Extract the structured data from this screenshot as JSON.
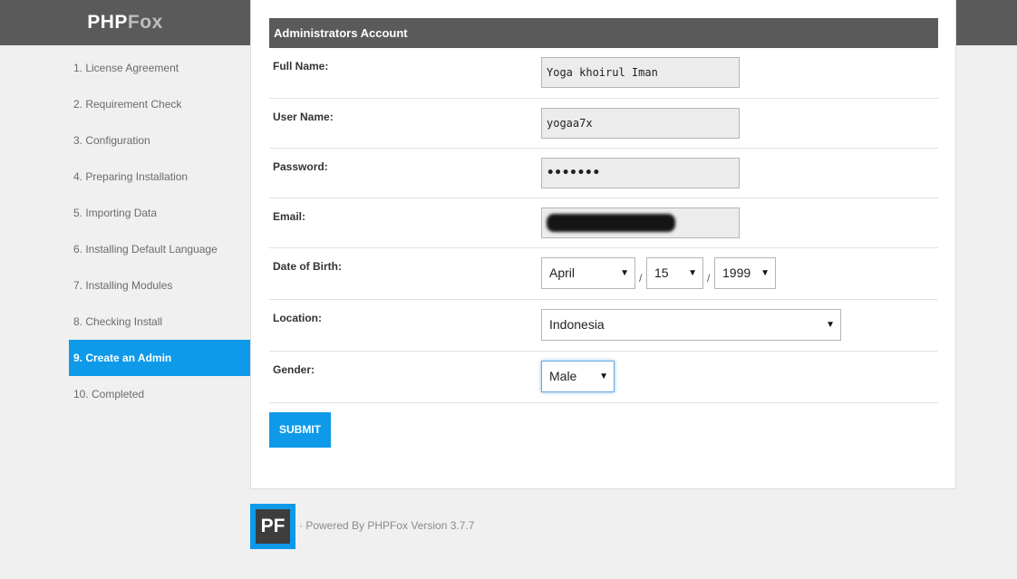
{
  "brand": {
    "part1": "PHP",
    "part2": "Fox"
  },
  "steps": [
    {
      "label": "1. License Agreement"
    },
    {
      "label": "2. Requirement Check"
    },
    {
      "label": "3. Configuration"
    },
    {
      "label": "4. Preparing Installation"
    },
    {
      "label": "5. Importing Data"
    },
    {
      "label": "6. Installing Default Language"
    },
    {
      "label": "7. Installing Modules"
    },
    {
      "label": "8. Checking Install"
    },
    {
      "label": "9. Create an Admin",
      "active": true
    },
    {
      "label": "10. Completed"
    }
  ],
  "panel": {
    "title": "Administrators Account"
  },
  "form": {
    "full_name": {
      "label": "Full Name:",
      "value": "Yoga khoirul Iman"
    },
    "user_name": {
      "label": "User Name:",
      "value": "yogaa7x"
    },
    "password": {
      "label": "Password:",
      "value": "•••••••"
    },
    "email": {
      "label": "Email:",
      "value": ""
    },
    "dob": {
      "label": "Date of Birth:",
      "month": "April",
      "day": "15",
      "year": "1999",
      "separator": "/"
    },
    "location": {
      "label": "Location:",
      "value": "Indonesia"
    },
    "gender": {
      "label": "Gender:",
      "value": "Male"
    },
    "submit_label": "SUBMIT"
  },
  "footer": {
    "logo_text": "PF",
    "powered_by": "· Powered By PHPFox Version 3.7.7"
  },
  "colors": {
    "accent": "#0e9ae9",
    "header": "#5a5a5a",
    "background": "#f0f0f0"
  }
}
